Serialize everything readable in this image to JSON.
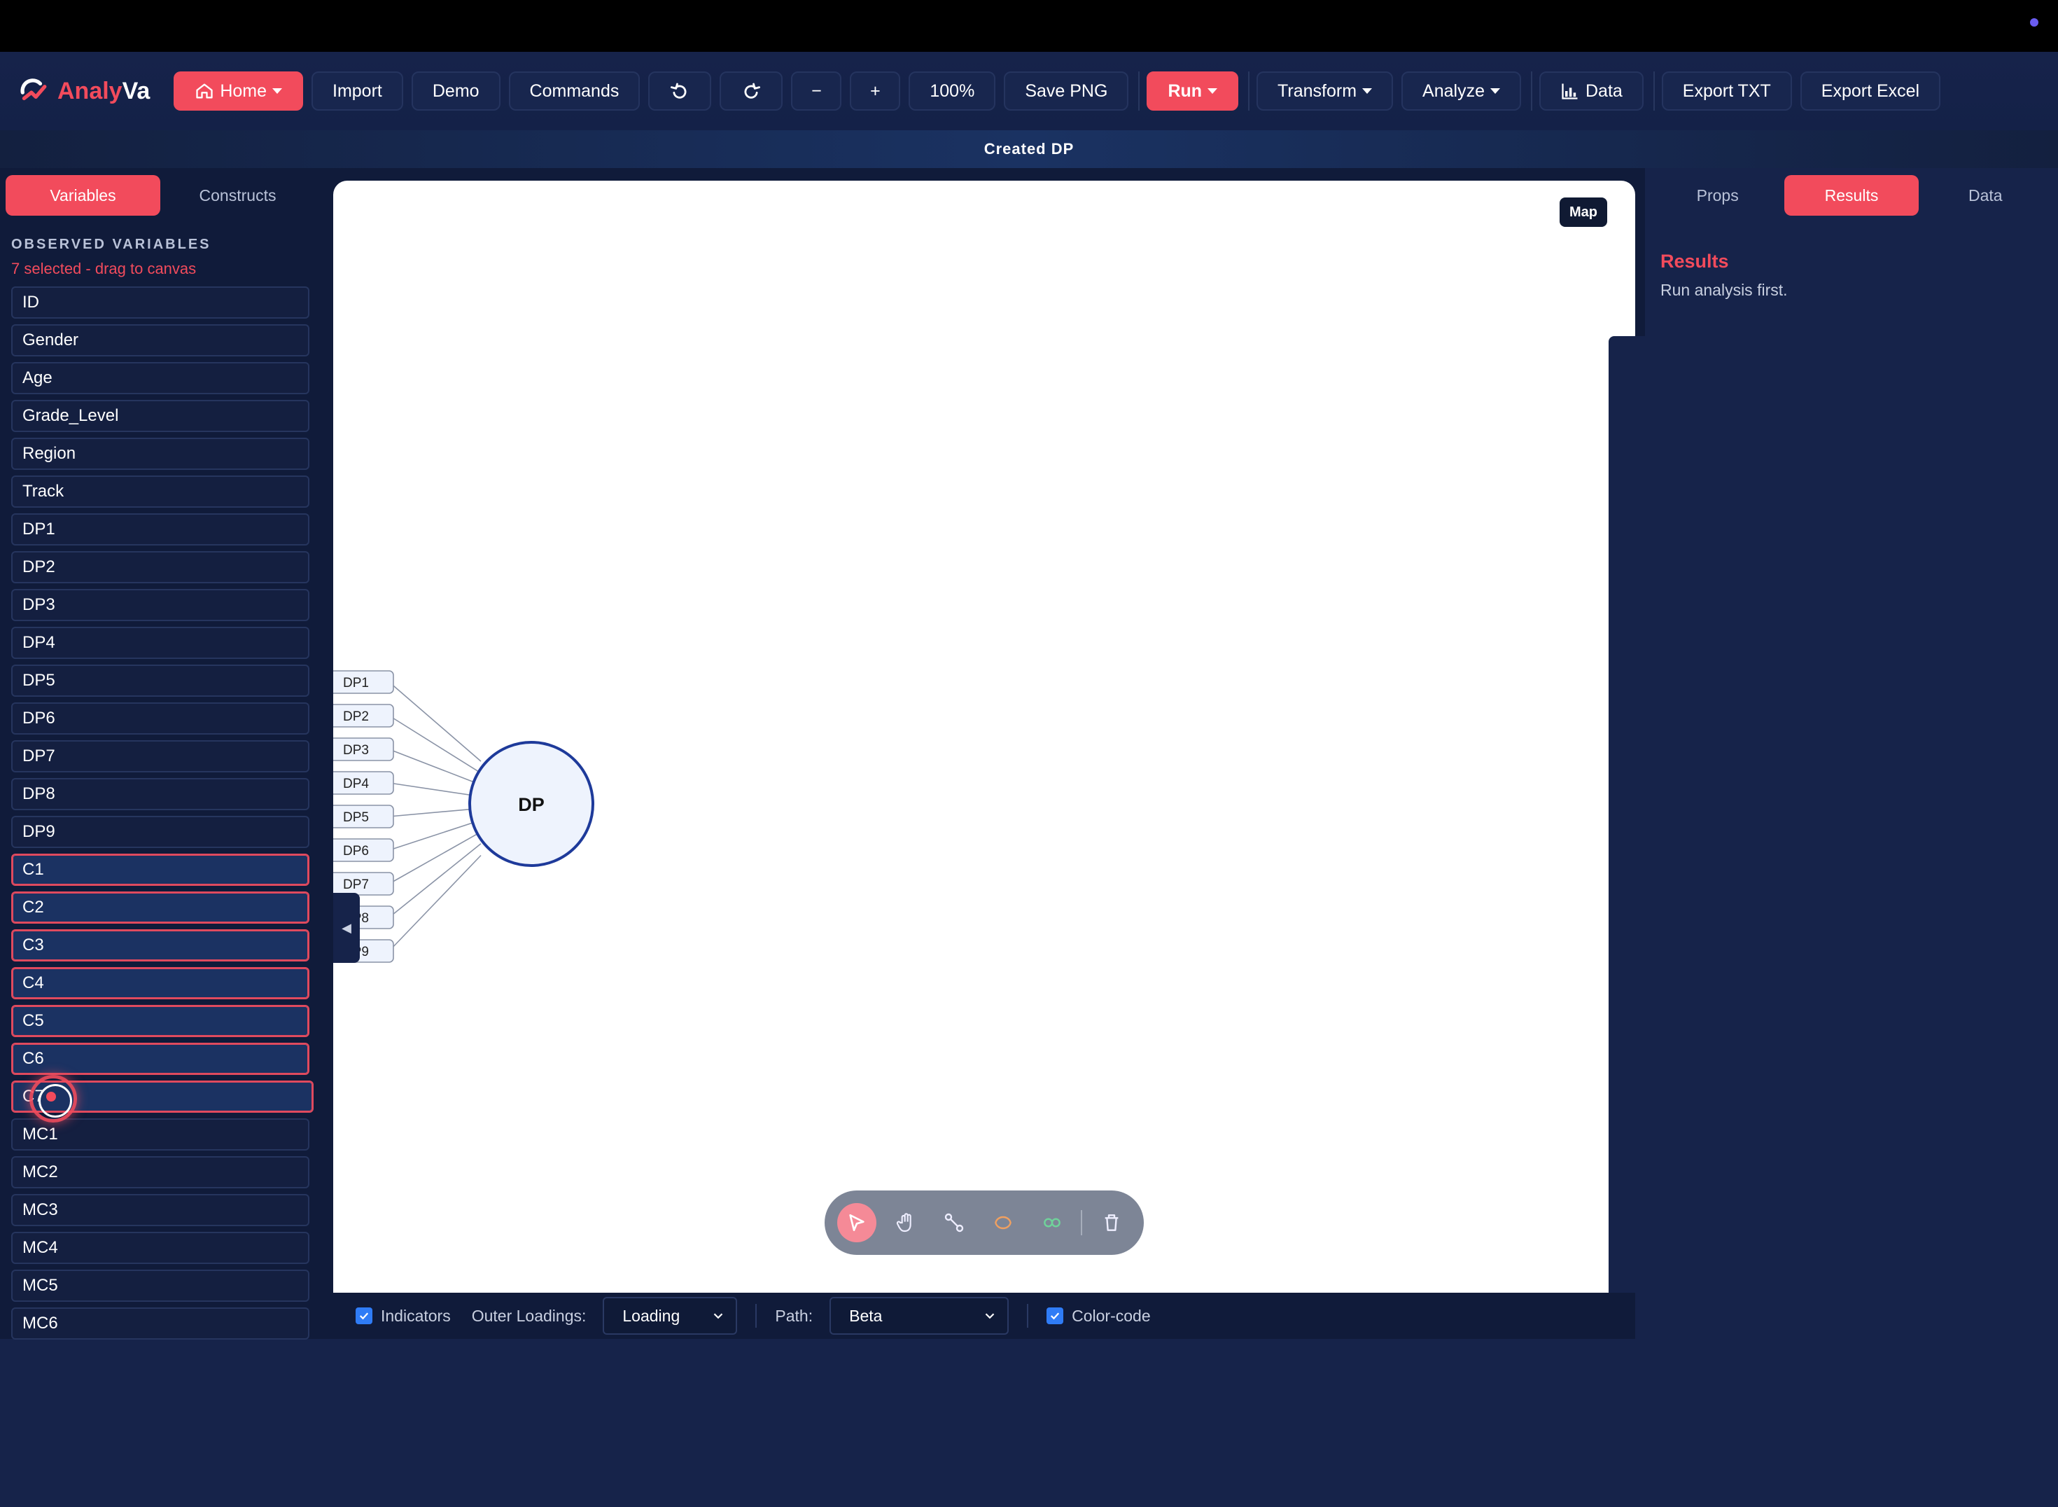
{
  "app": {
    "name_part1": "Analy",
    "name_part2": "Va",
    "logo_icon": "analyva-logo-icon"
  },
  "toolbar": {
    "home": "Home",
    "import": "Import",
    "demo": "Demo",
    "commands": "Commands",
    "undo_icon": "undo-icon",
    "redo_icon": "redo-icon",
    "zoom_out": "−",
    "zoom_in": "+",
    "zoom_level": "100%",
    "save_png": "Save PNG",
    "run": "Run",
    "transform": "Transform",
    "analyze": "Analyze",
    "data": "Data",
    "export_txt": "Export TXT",
    "export_excel": "Export Excel"
  },
  "status": {
    "message": "Created DP"
  },
  "left_panel": {
    "tabs": [
      "Variables",
      "Constructs"
    ],
    "section_title": "OBSERVED VARIABLES",
    "selection_hint": "7 selected - drag to canvas",
    "variables": [
      {
        "name": "ID",
        "selected": false
      },
      {
        "name": "Gender",
        "selected": false
      },
      {
        "name": "Age",
        "selected": false
      },
      {
        "name": "Grade_Level",
        "selected": false
      },
      {
        "name": "Region",
        "selected": false
      },
      {
        "name": "Track",
        "selected": false
      },
      {
        "name": "DP1",
        "selected": false
      },
      {
        "name": "DP2",
        "selected": false
      },
      {
        "name": "DP3",
        "selected": false
      },
      {
        "name": "DP4",
        "selected": false
      },
      {
        "name": "DP5",
        "selected": false
      },
      {
        "name": "DP6",
        "selected": false
      },
      {
        "name": "DP7",
        "selected": false
      },
      {
        "name": "DP8",
        "selected": false
      },
      {
        "name": "DP9",
        "selected": false
      },
      {
        "name": "C1",
        "selected": true
      },
      {
        "name": "C2",
        "selected": true
      },
      {
        "name": "C3",
        "selected": true
      },
      {
        "name": "C4",
        "selected": true
      },
      {
        "name": "C5",
        "selected": true
      },
      {
        "name": "C6",
        "selected": true
      },
      {
        "name": "C7",
        "selected": true
      },
      {
        "name": "MC1",
        "selected": false
      },
      {
        "name": "MC2",
        "selected": false
      },
      {
        "name": "MC3",
        "selected": false
      },
      {
        "name": "MC4",
        "selected": false
      },
      {
        "name": "MC5",
        "selected": false
      },
      {
        "name": "MC6",
        "selected": false
      }
    ]
  },
  "canvas": {
    "map_button": "Map",
    "construct": "DP",
    "indicators": [
      "DP1",
      "DP2",
      "DP3",
      "DP4",
      "DP5",
      "DP6",
      "DP7",
      "DP8",
      "DP9"
    ],
    "left_handle": "◀",
    "right_handle": "▶"
  },
  "bottom_bar": {
    "indicators_label": "Indicators",
    "outer_loadings_label": "Outer Loadings:",
    "outer_loadings_value": "Loading",
    "path_label": "Path:",
    "path_value": "Beta",
    "color_code_label": "Color-code"
  },
  "right_panel": {
    "tabs": [
      "Props",
      "Results",
      "Data"
    ],
    "results_title": "Results",
    "results_text": "Run analysis first."
  },
  "colors": {
    "accent": "#f24b5c",
    "panel": "#16234a",
    "construct_stroke": "#1e3a9a"
  }
}
